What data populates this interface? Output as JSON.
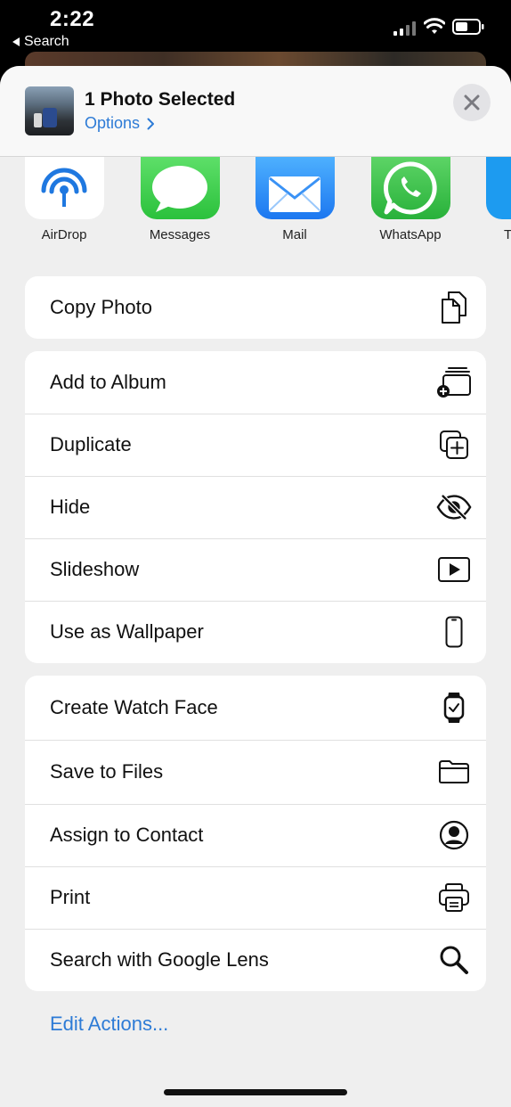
{
  "status": {
    "time": "2:22",
    "back_label": "Search"
  },
  "header": {
    "title": "1 Photo Selected",
    "options_label": "Options"
  },
  "apps": [
    {
      "label": "AirDrop",
      "icon": "airdrop-icon"
    },
    {
      "label": "Messages",
      "icon": "messages-icon"
    },
    {
      "label": "Mail",
      "icon": "mail-icon"
    },
    {
      "label": "WhatsApp",
      "icon": "whatsapp-icon"
    },
    {
      "label": "T",
      "icon": "twitter-icon"
    }
  ],
  "groups": [
    [
      {
        "label": "Copy Photo",
        "icon": "copy-icon"
      }
    ],
    [
      {
        "label": "Add to Album",
        "icon": "add-to-album-icon"
      },
      {
        "label": "Duplicate",
        "icon": "duplicate-icon"
      },
      {
        "label": "Hide",
        "icon": "eye-slash-icon"
      },
      {
        "label": "Slideshow",
        "icon": "play-icon"
      },
      {
        "label": "Use as Wallpaper",
        "icon": "phone-icon"
      }
    ],
    [
      {
        "label": "Create Watch Face",
        "icon": "watch-icon"
      },
      {
        "label": "Save to Files",
        "icon": "folder-icon"
      },
      {
        "label": "Assign to Contact",
        "icon": "person-circle-icon"
      },
      {
        "label": "Print",
        "icon": "printer-icon"
      },
      {
        "label": "Search with Google Lens",
        "icon": "search-icon"
      }
    ]
  ],
  "edit_actions_label": "Edit Actions...",
  "colors": {
    "accent": "#2d7bd6",
    "sheet_bg": "#efefef"
  }
}
